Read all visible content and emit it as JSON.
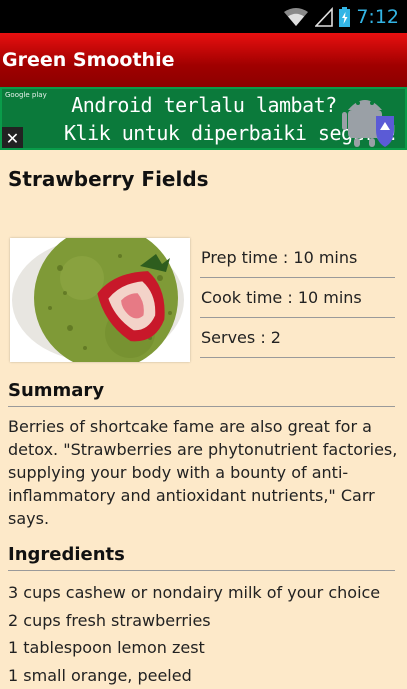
{
  "status_bar": {
    "time": "7:12",
    "wifi_icon": "wifi-icon",
    "signal_icon": "signal-icon",
    "battery_icon": "battery-icon"
  },
  "app_bar": {
    "title": "Green Smoothie"
  },
  "ad": {
    "line1": "Android terlalu lambat?",
    "line2": "Klik untuk diperbaiki segera!",
    "source": "Google play",
    "close": "✕"
  },
  "recipe": {
    "title": "Strawberry Fields",
    "prep_time": "Prep time : 10 mins",
    "cook_time": "Cook time : 10 mins",
    "serves": "Serves : 2"
  },
  "summary": {
    "heading": "Summary",
    "text": "Berries of shortcake fame are also great for a detox. \"Strawberries are phytonutrient factories, supplying your body with a bounty of anti-inflammatory and antioxidant nutrients,\" Carr says."
  },
  "ingredients": {
    "heading": "Ingredients",
    "items": [
      "3 cups cashew or nondairy milk of your choice",
      "2 cups fresh strawberries",
      "1 tablespoon lemon zest",
      "1 small orange, peeled"
    ]
  }
}
